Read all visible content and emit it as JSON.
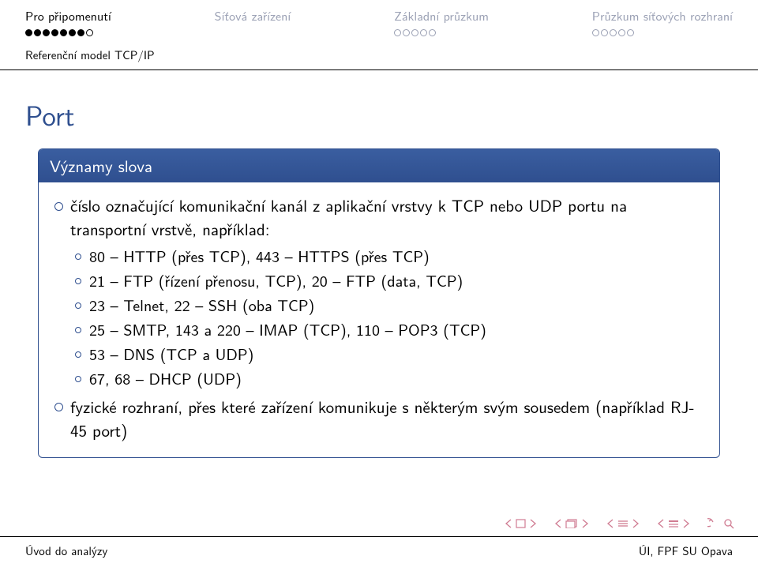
{
  "nav": {
    "sections": [
      {
        "label": "Pro připomenutí",
        "dots": [
          "f",
          "f",
          "f",
          "f",
          "f",
          "f",
          "f",
          "c"
        ],
        "active": true
      },
      {
        "label": "Síťová zařízení",
        "dots": [],
        "active": false
      },
      {
        "label": "Základní průzkum",
        "dots": [
          "e",
          "e",
          "e",
          "e",
          "e"
        ],
        "active": false
      },
      {
        "label": "Průzkum síťových rozhraní",
        "dots": [
          "e",
          "e",
          "e",
          "e",
          "e"
        ],
        "active": false
      }
    ],
    "subsection": "Referenční model TCP/IP"
  },
  "title": "Port",
  "block": {
    "title": "Významy slova",
    "items": [
      {
        "text": "číslo označující komunikační kanál z aplikační vrstvy k TCP nebo UDP portu na transportní vrstvě, například:",
        "sub": [
          "80 – HTTP (přes TCP), 443 – HTTPS (přes TCP)",
          "21 – FTP (řízení přenosu, TCP), 20 – FTP (data, TCP)",
          "23 – Telnet, 22 – SSH (oba TCP)",
          "25 – SMTP, 143 a 220 – IMAP (TCP), 110 – POP3 (TCP)",
          "53 – DNS (TCP a UDP)",
          "67, 68 – DHCP (UDP)"
        ]
      },
      {
        "text": "fyzické rozhraní, přes které zařízení komunikuje s některým svým sousedem (například RJ-45 port)",
        "sub": []
      }
    ]
  },
  "footer": {
    "left": "Úvod do analýzy",
    "right": "ÚI, FPF SU Opava"
  }
}
